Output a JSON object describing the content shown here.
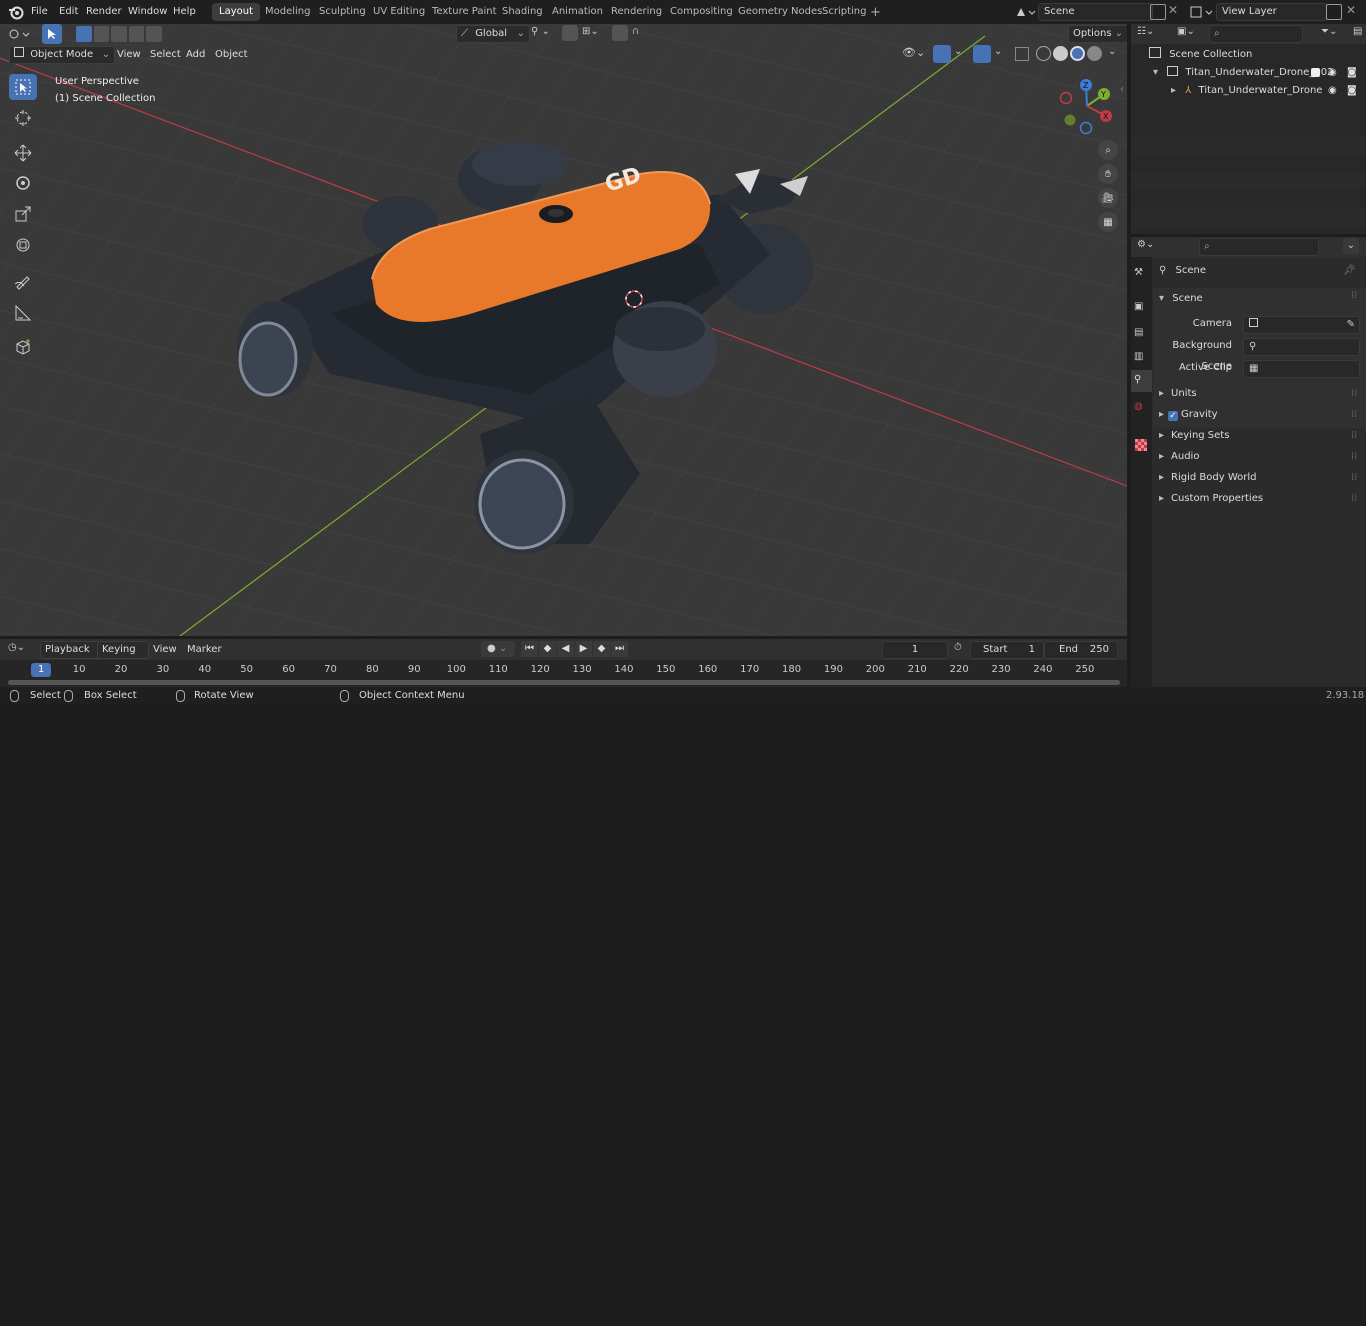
{
  "menubar": {
    "items": [
      "File",
      "Edit",
      "Render",
      "Window",
      "Help"
    ],
    "workspaces": [
      "Layout",
      "Modeling",
      "Sculpting",
      "UV Editing",
      "Texture Paint",
      "Shading",
      "Animation",
      "Rendering",
      "Compositing",
      "Geometry Nodes",
      "Scripting"
    ],
    "active_workspace": "Layout",
    "add_tab": "+",
    "scene_name": "Scene",
    "view_layer": "View Layer"
  },
  "viewport_header": {
    "mode": "Object Mode",
    "menus": [
      "View",
      "Select",
      "Add",
      "Object"
    ],
    "transform_orientation": "Global",
    "options": "Options"
  },
  "viewport": {
    "perspective_label": "User Perspective",
    "collection_label": "(1) Scene Collection",
    "gizmo_axes": {
      "x": "X",
      "y": "Y",
      "z": "Z"
    }
  },
  "outliner": {
    "scene_collection": "Scene Collection",
    "items": [
      {
        "name": "Titan_Underwater_Drone_002"
      },
      {
        "name": "Titan_Underwater_Drone"
      }
    ]
  },
  "properties": {
    "context_title": "Scene",
    "panel_title": "Scene",
    "fields": [
      {
        "label": "Camera",
        "value": ""
      },
      {
        "label": "Background Scene",
        "value": ""
      },
      {
        "label": "Active Clip",
        "value": ""
      }
    ],
    "subpanels": [
      "Units",
      "Gravity",
      "Keying Sets",
      "Audio",
      "Rigid Body World",
      "Custom Properties"
    ]
  },
  "timeline": {
    "menus": [
      "Playback",
      "Keying",
      "View",
      "Marker"
    ],
    "current_frame": "1",
    "start_label": "Start",
    "start_value": "1",
    "end_label": "End",
    "end_value": "250",
    "ruler_ticks": [
      "1",
      "10",
      "20",
      "30",
      "40",
      "50",
      "60",
      "70",
      "80",
      "90",
      "100",
      "110",
      "120",
      "130",
      "140",
      "150",
      "160",
      "170",
      "180",
      "190",
      "200",
      "210",
      "220",
      "230",
      "240",
      "250"
    ]
  },
  "statusbar": {
    "select": "Select",
    "box_select": "Box Select",
    "rotate_view": "Rotate View",
    "context_menu": "Object Context Menu",
    "version": "2.93.18"
  },
  "colors": {
    "accent": "#4772b3",
    "orange": "#e8782a",
    "x_axis": "#c03b4a",
    "y_axis": "#7fad2e"
  }
}
